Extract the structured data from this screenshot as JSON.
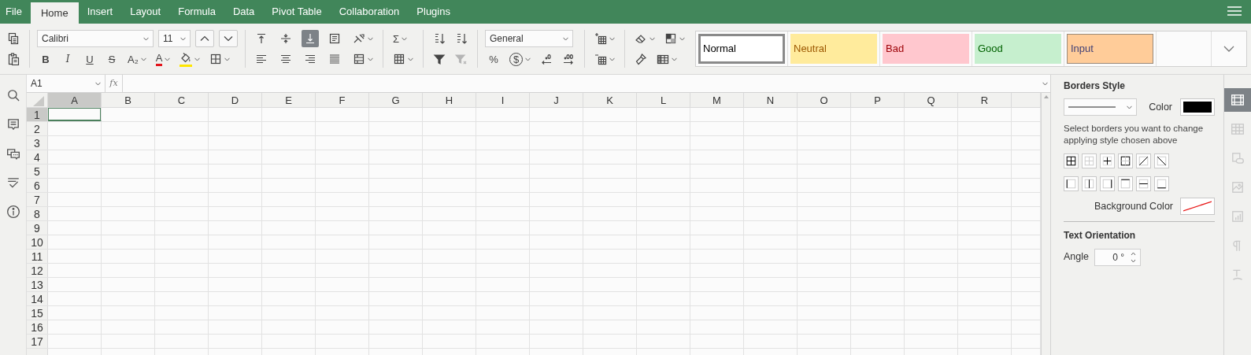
{
  "menu": {
    "tabs": [
      {
        "label": "File",
        "selected": false
      },
      {
        "label": "Home",
        "selected": true
      },
      {
        "label": "Insert",
        "selected": false
      },
      {
        "label": "Layout",
        "selected": false
      },
      {
        "label": "Formula",
        "selected": false
      },
      {
        "label": "Data",
        "selected": false
      },
      {
        "label": "Pivot Table",
        "selected": false
      },
      {
        "label": "Collaboration",
        "selected": false
      },
      {
        "label": "Plugins",
        "selected": false
      }
    ]
  },
  "toolbar": {
    "groups": [
      {
        "rows": [
          [
            {
              "kind": "button",
              "dropdown": false
            }
          ],
          [
            {
              "kind": "button",
              "dropdown": false
            }
          ]
        ]
      },
      {
        "rows": [
          [
            {
              "kind": "select",
              "value": "Calibri"
            },
            {
              "kind": "select",
              "value": "11"
            },
            {
              "kind": "button",
              "dropdown": false
            },
            {
              "kind": "button",
              "dropdown": false
            }
          ],
          [
            {
              "kind": "button",
              "label": "B",
              "dropdown": false
            },
            {
              "kind": "button",
              "label": "I",
              "dropdown": false
            },
            {
              "kind": "button",
              "label": "U",
              "dropdown": false
            },
            {
              "kind": "button",
              "label": "S",
              "dropdown": false
            },
            {
              "kind": "button",
              "label": "A₂",
              "dropdown": true
            },
            {
              "kind": "button",
              "label": "A",
              "dropdown": true
            },
            {
              "kind": "button",
              "dropdown": true
            },
            {
              "kind": "button",
              "dropdown": true
            }
          ]
        ]
      },
      {
        "rows": [
          [
            {
              "kind": "button",
              "dropdown": false,
              "selected": false
            },
            {
              "kind": "button",
              "dropdown": false,
              "selected": false
            },
            {
              "kind": "button",
              "dropdown": false,
              "selected": true
            },
            {
              "kind": "button",
              "dropdown": false
            },
            {
              "kind": "button",
              "dropdown": true
            }
          ],
          [
            {
              "kind": "button",
              "dropdown": false,
              "selected": false
            },
            {
              "kind": "button",
              "dropdown": false,
              "selected": false
            },
            {
              "kind": "button",
              "dropdown": false,
              "selected": false
            },
            {
              "kind": "button",
              "dropdown": false,
              "selected": false
            },
            {
              "kind": "button",
              "dropdown": true
            }
          ]
        ]
      },
      {
        "rows": [
          [
            {
              "kind": "button",
              "label": "Σ",
              "dropdown": true
            }
          ],
          [
            {
              "kind": "button",
              "dropdown": true
            }
          ]
        ]
      },
      {
        "rows": [
          [
            {
              "kind": "button",
              "dropdown": false
            },
            {
              "kind": "button",
              "dropdown": false
            }
          ],
          [
            {
              "kind": "button",
              "dropdown": false,
              "disabled": false
            },
            {
              "kind": "button",
              "dropdown": false,
              "disabled": true
            }
          ]
        ]
      },
      {
        "rows": [
          [
            {
              "kind": "select",
              "value": "General"
            }
          ],
          [
            {
              "kind": "button",
              "label": "%",
              "dropdown": false
            },
            {
              "kind": "button",
              "label": "$",
              "dropdown": true
            },
            {
              "kind": "button",
              "dropdown": false
            },
            {
              "kind": "button",
              "dropdown": false
            }
          ]
        ]
      },
      {
        "rows": [
          [
            {
              "kind": "button",
              "dropdown": true
            }
          ],
          [
            {
              "kind": "button",
              "dropdown": true
            }
          ]
        ]
      },
      {
        "rows": [
          [
            {
              "kind": "button",
              "dropdown": true
            },
            {
              "kind": "button",
              "dropdown": true
            }
          ],
          [
            {
              "kind": "button",
              "dropdown": false
            },
            {
              "kind": "button",
              "dropdown": true
            }
          ]
        ]
      }
    ]
  },
  "cell_styles": [
    {
      "label": "Normal",
      "color": "#ffffff",
      "selected": true
    },
    {
      "label": "Neutral",
      "color": "#ffeb9c",
      "selected": false
    },
    {
      "label": "Bad",
      "color": "#ffc7ce",
      "selected": false
    },
    {
      "label": "Good",
      "color": "#c6efce",
      "selected": false
    },
    {
      "label": "Input",
      "color": "#ffcc99",
      "selected": false
    }
  ],
  "formula_bar": {
    "name_box": "A1",
    "fx_label": "fx"
  },
  "sheet": {
    "columns": [
      {
        "label": "A",
        "selected": true
      },
      {
        "label": "B",
        "selected": false
      },
      {
        "label": "C",
        "selected": false
      },
      {
        "label": "D",
        "selected": false
      },
      {
        "label": "E",
        "selected": false
      },
      {
        "label": "F",
        "selected": false
      },
      {
        "label": "G",
        "selected": false
      },
      {
        "label": "H",
        "selected": false
      },
      {
        "label": "I",
        "selected": false
      },
      {
        "label": "J",
        "selected": false
      },
      {
        "label": "K",
        "selected": false
      },
      {
        "label": "L",
        "selected": false
      },
      {
        "label": "M",
        "selected": false
      },
      {
        "label": "N",
        "selected": false
      },
      {
        "label": "O",
        "selected": false
      },
      {
        "label": "P",
        "selected": false
      },
      {
        "label": "Q",
        "selected": false
      },
      {
        "label": "R",
        "selected": false
      }
    ],
    "rows": [
      {
        "label": "1",
        "selected": true
      },
      {
        "label": "2",
        "selected": false
      },
      {
        "label": "3",
        "selected": false
      },
      {
        "label": "4",
        "selected": false
      },
      {
        "label": "5",
        "selected": false
      },
      {
        "label": "6",
        "selected": false
      },
      {
        "label": "7",
        "selected": false
      },
      {
        "label": "8",
        "selected": false
      },
      {
        "label": "9",
        "selected": false
      },
      {
        "label": "10",
        "selected": false
      },
      {
        "label": "11",
        "selected": false
      },
      {
        "label": "12",
        "selected": false
      },
      {
        "label": "13",
        "selected": false
      },
      {
        "label": "14",
        "selected": false
      },
      {
        "label": "15",
        "selected": false
      },
      {
        "label": "16",
        "selected": false
      },
      {
        "label": "17",
        "selected": false
      }
    ]
  },
  "format_panel": {
    "title": "Borders Style",
    "color_label": "Color",
    "hint": "Select borders you want to change applying style chosen above",
    "background_label": "Background Color",
    "orientation_title": "Text Orientation",
    "angle_label": "Angle",
    "angle_value": "0 °"
  },
  "side_tabs": [
    {
      "selected": true
    },
    {
      "selected": false
    },
    {
      "selected": false
    },
    {
      "selected": false
    },
    {
      "selected": false
    },
    {
      "selected": false
    },
    {
      "selected": false
    }
  ]
}
